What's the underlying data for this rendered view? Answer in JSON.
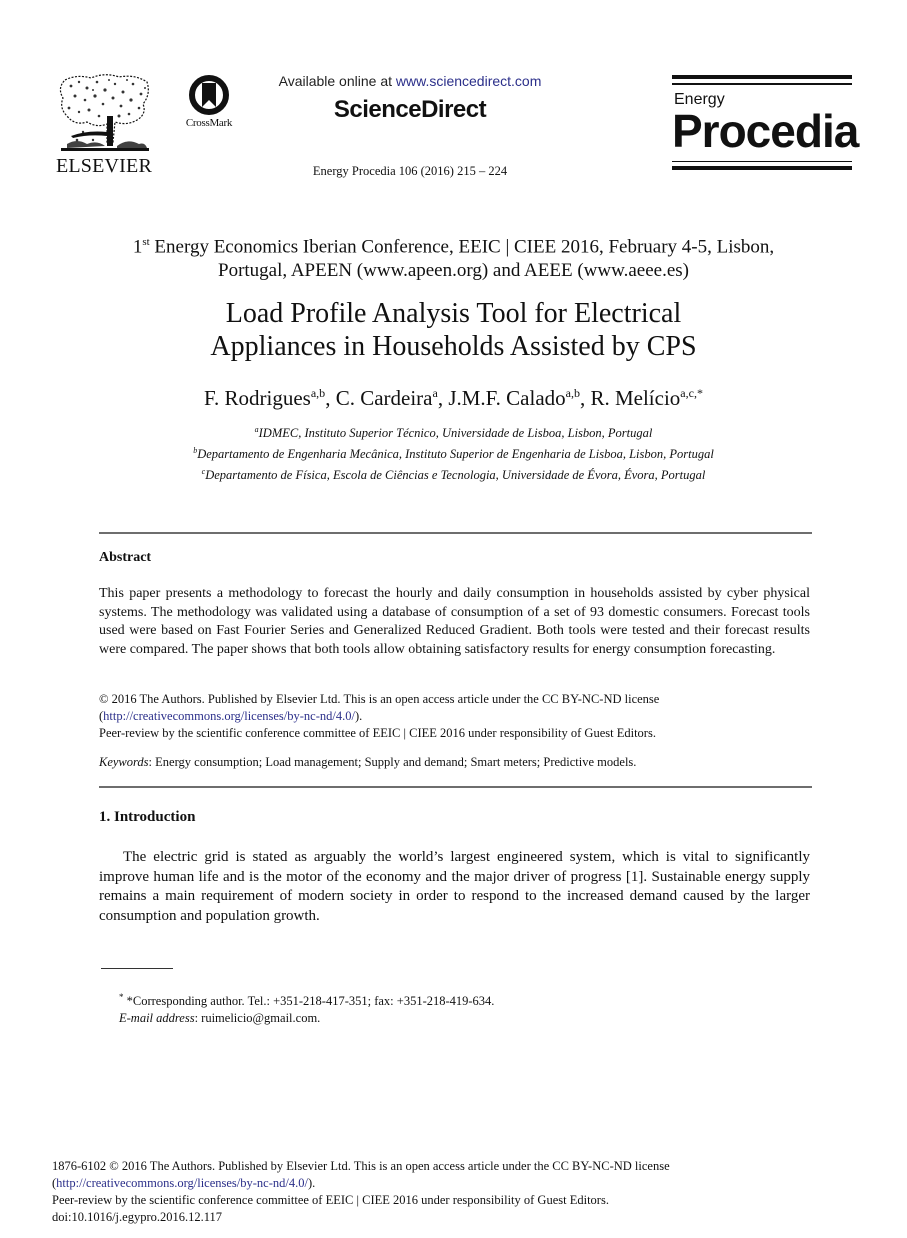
{
  "header": {
    "publisher_logo_text": "ELSEVIER",
    "crossmark_label": "CrossMark",
    "available_prefix": "Available online at ",
    "available_link": "www.sciencedirect.com",
    "platform_name": "ScienceDirect",
    "journal_reference": "Energy Procedia 106 (2016) 215 – 224",
    "journal_logo": {
      "top_word": "Energy",
      "main_word": "Procedia"
    }
  },
  "conference": {
    "ordinal_number": "1",
    "ordinal_suffix": "st",
    "line1_rest": " Energy Economics Iberian Conference, EEIC | CIEE 2016, February 4-5, Lisbon,",
    "line2": "Portugal, APEEN (www.apeen.org) and AEEE (www.aeee.es)"
  },
  "paper": {
    "title_line1": "Load Profile Analysis Tool for Electrical",
    "title_line2": "Appliances in Households Assisted by CPS",
    "authors": [
      {
        "name": "F. Rodrigues",
        "affil": "a,b",
        "sep": ", "
      },
      {
        "name": "C. Cardeira",
        "affil": "a",
        "sep": ", "
      },
      {
        "name": "J.M.F. Calado",
        "affil": "a,b",
        "sep": ", "
      },
      {
        "name": "R. Melício",
        "affil": "a,c,*",
        "sep": ""
      }
    ],
    "affiliations": [
      {
        "mark": "a",
        "text": "IDMEC, Instituto Superior Técnico, Universidade de Lisboa, Lisbon, Portugal"
      },
      {
        "mark": "b",
        "text": "Departamento de Engenharia Mecânica, Instituto Superior de Engenharia de Lisboa, Lisbon, Portugal"
      },
      {
        "mark": "c",
        "text": "Departamento de Física, Escola de Ciências e Tecnologia, Universidade de Évora, Évora, Portugal"
      }
    ]
  },
  "abstract": {
    "heading": "Abstract",
    "body": "This paper presents a methodology to forecast the hourly and daily consumption in households assisted by cyber physical systems. The methodology was validated using a database of consumption of a set of 93 domestic consumers. Forecast tools used were based on Fast Fourier Series and Generalized Reduced Gradient. Both tools were tested and their forecast results were compared. The paper shows that both tools allow obtaining satisfactory results for energy consumption forecasting.",
    "license_line1": "© 2016 The Authors. Published by Elsevier Ltd. This is an open access article under the CC BY-NC-ND license",
    "license_link_open": "(",
    "license_link": "http://creativecommons.org/licenses/by-nc-nd/4.0/",
    "license_link_close": ").",
    "peer_review": "Peer-review by the scientific conference committee of EEIC | CIEE 2016 under responsibility of Guest Editors.",
    "keywords_label": "Keywords",
    "keywords_text": ": Energy consumption; Load management; Supply and demand; Smart meters; Predictive models."
  },
  "introduction": {
    "heading": "1. Introduction",
    "body": "The electric grid is stated as arguably the world’s largest engineered system, which is vital to significantly improve human life and is the motor of the economy and the major driver of progress [1]. Sustainable energy supply remains a main requirement of modern society in order to respond to the increased demand caused by the larger consumption and population growth."
  },
  "footnote": {
    "mark": "*",
    "corresponding": " *Corresponding author. Tel.: +351-218-417-351; fax: +351-218-419-634.",
    "email_label": "E-mail address",
    "email_value": ": ruimelicio@gmail.com."
  },
  "bottom_meta": {
    "issn_license": "1876-6102 © 2016 The Authors. Published by Elsevier Ltd. This is an open access article under the CC BY-NC-ND license",
    "license_link_open": "(",
    "license_link": "http://creativecommons.org/licenses/by-nc-nd/4.0/",
    "license_link_close": ").",
    "peer_review": "Peer-review by the scientific conference committee of EEIC | CIEE 2016 under responsibility of Guest Editors.",
    "doi": "doi:10.1016/j.egypro.2016.12.117"
  },
  "colors": {
    "link": "#2b2f8a",
    "rule": "#6e6e6e",
    "text": "#111111"
  }
}
